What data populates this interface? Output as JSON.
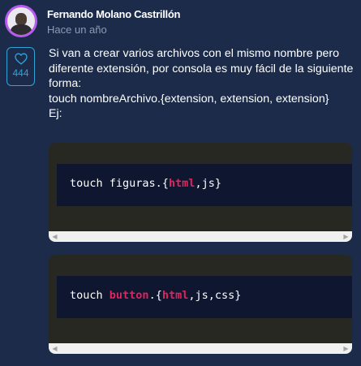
{
  "comment": {
    "author": "Fernando Molano Castrillón",
    "time": "Hace un año",
    "likes": "444",
    "text_lines": [
      "Si van a crear varios archivos con el mismo nombre pero",
      "diferente extensión, por consola es muy fácil de la siguiente",
      "forma:",
      "touch nombreArchivo.{extension, extension, extension}",
      "Ej:"
    ]
  },
  "code_blocks": [
    {
      "prefix": "touch figuras.{",
      "highlight": "html",
      "suffix": ",js}"
    },
    {
      "prefix": "touch ",
      "highlight_1": "button",
      "middle": ".{",
      "highlight_2": "html",
      "suffix": ",js,css}"
    }
  ],
  "icons": {
    "like": "heart-icon",
    "scroll_left": "chevron-left-icon",
    "scroll_right": "chevron-right-icon"
  },
  "colors": {
    "background": "#1c2b4a",
    "accent": "#30a3d8",
    "keyword": "#e0245e",
    "code_outer": "#272822",
    "code_inner": "#0e1630"
  }
}
